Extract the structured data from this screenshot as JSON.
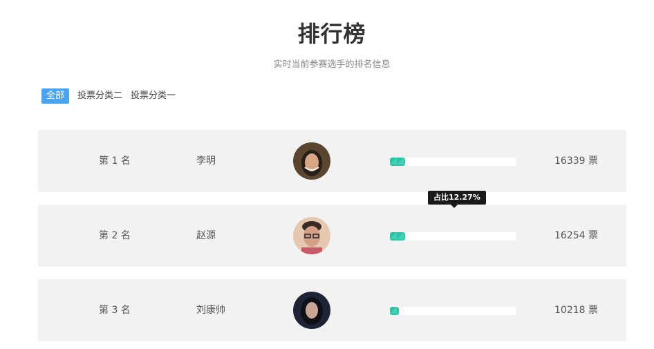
{
  "header": {
    "title": "排行榜",
    "subtitle": "实时当前参赛选手的排名信息"
  },
  "tabs": [
    {
      "label": "全部",
      "active": true
    },
    {
      "label": "投票分类二",
      "active": false
    },
    {
      "label": "投票分类一",
      "active": false
    }
  ],
  "rankings": [
    {
      "rank": "第 1 名",
      "name": "李明",
      "share": 0.1227,
      "votes": "16339 票",
      "avatar_colors": [
        "#5a4630",
        "#d9a684",
        "#2a1e18"
      ]
    },
    {
      "rank": "第 2 名",
      "name": "赵源",
      "share": 0.1227,
      "votes": "16254 票",
      "tooltip": "占比12.27%",
      "avatar_colors": [
        "#e6c7b2",
        "#d4a088",
        "#3a2a24"
      ]
    },
    {
      "rank": "第 3 名",
      "name": "刘康帅",
      "share": 0.07,
      "votes": "10218 票",
      "avatar_colors": [
        "#1e2436",
        "#caa494",
        "#0f0f18"
      ]
    }
  ],
  "colors": {
    "accent_tab": "#4aa3f0",
    "bar_fill": "#2fc0a5",
    "row_bg": "#f2f2f2",
    "tooltip_bg": "#1a1a1a"
  }
}
